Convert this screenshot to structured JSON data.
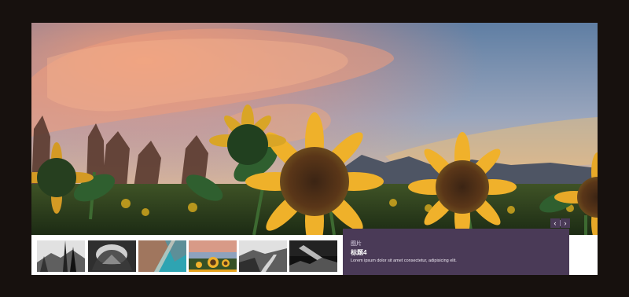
{
  "slideshow": {
    "current_slide_label": "图片",
    "current_slide_title": "标题4",
    "current_slide_description": "Lorem ipsum dolor sit amet consectetur, adipisicing elit.",
    "prev_icon": "‹",
    "next_icon": "›",
    "active_thumbnail_index": 3,
    "accent_color": "#e6a21c",
    "caption_color": "#4a3a57"
  }
}
